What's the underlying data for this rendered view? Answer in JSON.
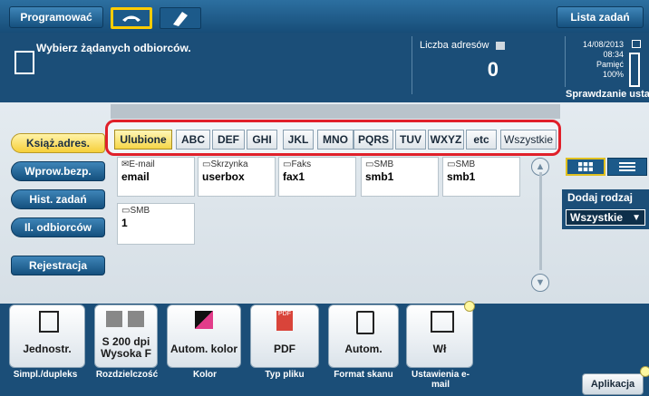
{
  "topbar": {
    "program_label": "Programować",
    "job_list_label": "Lista zadań"
  },
  "header": {
    "instruction": "Wybierz żądanych odbiorców.",
    "address_count_label": "Liczba adresów",
    "address_count": "0",
    "date": "14/08/2013",
    "time": "08:34",
    "memory_label": "Pamięć",
    "memory_value": "100%",
    "check_label": "Sprawdzanie ustaw"
  },
  "left_menu": [
    "Książ.adres.",
    "Wprow.bezp.",
    "Hist. zadań",
    "Il. odbiorców",
    "Rejestracja"
  ],
  "index_tabs": [
    "Ulubione",
    "ABC",
    "DEF",
    "GHI",
    "JKL",
    "MNO",
    "PQRS",
    "TUV",
    "WXYZ",
    "etc",
    "Wszystkie"
  ],
  "selected_tab": "Ulubione",
  "destinations": [
    {
      "type": "E-mail",
      "name": "email"
    },
    {
      "type": "Skrzynka",
      "name": "userbox"
    },
    {
      "type": "Faks",
      "name": "fax1"
    },
    {
      "type": "SMB",
      "name": "smb1"
    },
    {
      "type": "SMB",
      "name": "smb1"
    },
    {
      "type": "SMB",
      "name": "1"
    }
  ],
  "add_type": {
    "label": "Dodaj rodzaj",
    "value": "Wszystkie"
  },
  "functions": [
    {
      "name": "Jednostr.",
      "label": "Simpl./dupleks"
    },
    {
      "name": "S 200 dpi Wysoka F",
      "label": "Rozdzielczość"
    },
    {
      "name": "Autom. kolor",
      "label": "Kolor"
    },
    {
      "name": "PDF",
      "label": "Typ pliku"
    },
    {
      "name": "Autom.",
      "label": "Format skanu"
    },
    {
      "name": "Wł",
      "label": "Ustawienia e-mail"
    }
  ],
  "application_label": "Aplikacja",
  "colors": {
    "header_blue": "#1b4e78",
    "selected_yellow": "#f6d648",
    "highlight_red": "#e0202a"
  }
}
